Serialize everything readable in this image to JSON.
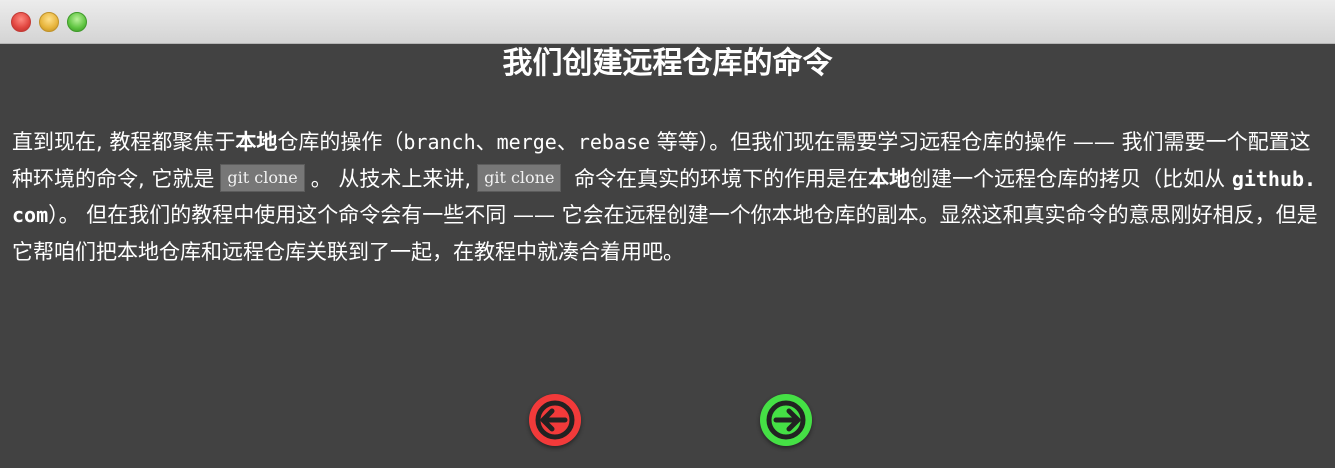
{
  "window": {
    "controls": [
      "close",
      "minimize",
      "maximize"
    ]
  },
  "content": {
    "title": "我们创建远程仓库的命令",
    "paragraph": {
      "p1": "直到现在, 教程都聚焦于",
      "b1": "本地",
      "p2": "仓库的操作（",
      "branch": "branch",
      "sep1": "、",
      "merge": "merge",
      "sep2": "、",
      "rebase": "rebase",
      "p3": " 等等）。但我们现在需要学习远程仓库的操作 —— 我们需要一个配置这种环境的命令, 它就是",
      "code1": "git clone",
      "p4": "。 从技术上来讲,",
      "code2": "git clone",
      "p5": " 命令在真实的环境下的作用是在",
      "b2": "本地",
      "p6": "创建一个远程仓库的拷贝（比如从 ",
      "github": "github.com",
      "p7": "）。 但在我们的教程中使用这个命令会有一些不同 —— 它会在远程创建一个你本地仓库的副本。显然这和真实命令的意思刚好相反，但是它帮咱们把本地仓库和远程仓库关联到了一起，在教程中就凑合着用吧。"
    }
  },
  "navigation": {
    "back_icon": "arrow-left-icon",
    "forward_icon": "arrow-right-icon",
    "back_color": "#f23a3a",
    "forward_color": "#45e045"
  }
}
